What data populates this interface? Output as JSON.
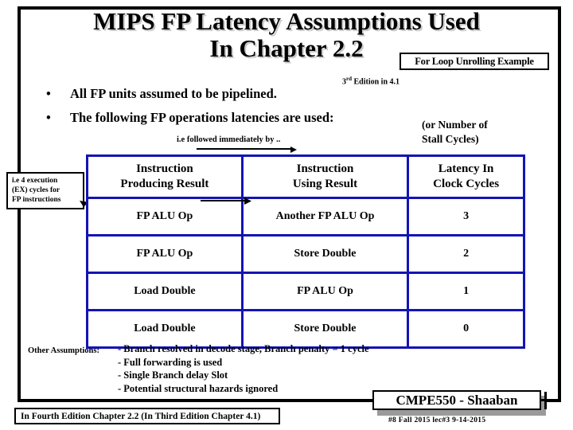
{
  "slide": {
    "title_line1": "MIPS FP Latency Assumptions Used",
    "title_line2": "In Chapter 2.2",
    "loop_box_label": "For Loop Unrolling Example",
    "edition_note_prefix": "3",
    "edition_note_sup": "rd",
    "edition_note_suffix": " Edition in 4.1"
  },
  "bullets": [
    {
      "marker": "•",
      "text": "All FP units assumed to be pipelined."
    },
    {
      "marker": "•",
      "text": "The following  FP operations latencies are used:"
    }
  ],
  "annotations": {
    "followed_immediately": "i.e followed immediately by ..",
    "stall_note_line1": "(or Number of",
    "stall_note_line2": "Stall  Cycles)",
    "callout_line1": "i.e 4 execution",
    "callout_line2": "(EX) cycles for",
    "callout_line3": "FP instructions"
  },
  "table": {
    "border_color": "#1414b4",
    "headers": [
      {
        "line1": "Instruction",
        "line2": "Producing Result"
      },
      {
        "line1": "Instruction",
        "line2": "Using Result"
      },
      {
        "line1": "Latency In",
        "line2": "Clock Cycles"
      }
    ],
    "rows": [
      {
        "producing": "FP ALU Op",
        "using": "Another FP ALU Op",
        "latency": "3"
      },
      {
        "producing": "FP ALU Op",
        "using": "Store Double",
        "latency": "2"
      },
      {
        "producing": "Load Double",
        "using": "FP ALU Op",
        "latency": "1"
      },
      {
        "producing": "Load Double",
        "using": "Store Double",
        "latency": "0"
      }
    ]
  },
  "other_assumptions": {
    "label": "Other Assumptions:",
    "items": [
      "- Branch resolved in decode stage,  Branch penalty = 1 cycle",
      "- Full forwarding is used",
      "- Single Branch delay Slot",
      "- Potential structural hazards ignored"
    ]
  },
  "footer": {
    "fourth_edition_note": "In Fourth Edition Chapter 2.2 (In Third Edition Chapter 4.1)",
    "course_label": "CMPE550 - Shaaban",
    "page_note": "#8  Fall 2015  lec#3  9-14-2015"
  }
}
